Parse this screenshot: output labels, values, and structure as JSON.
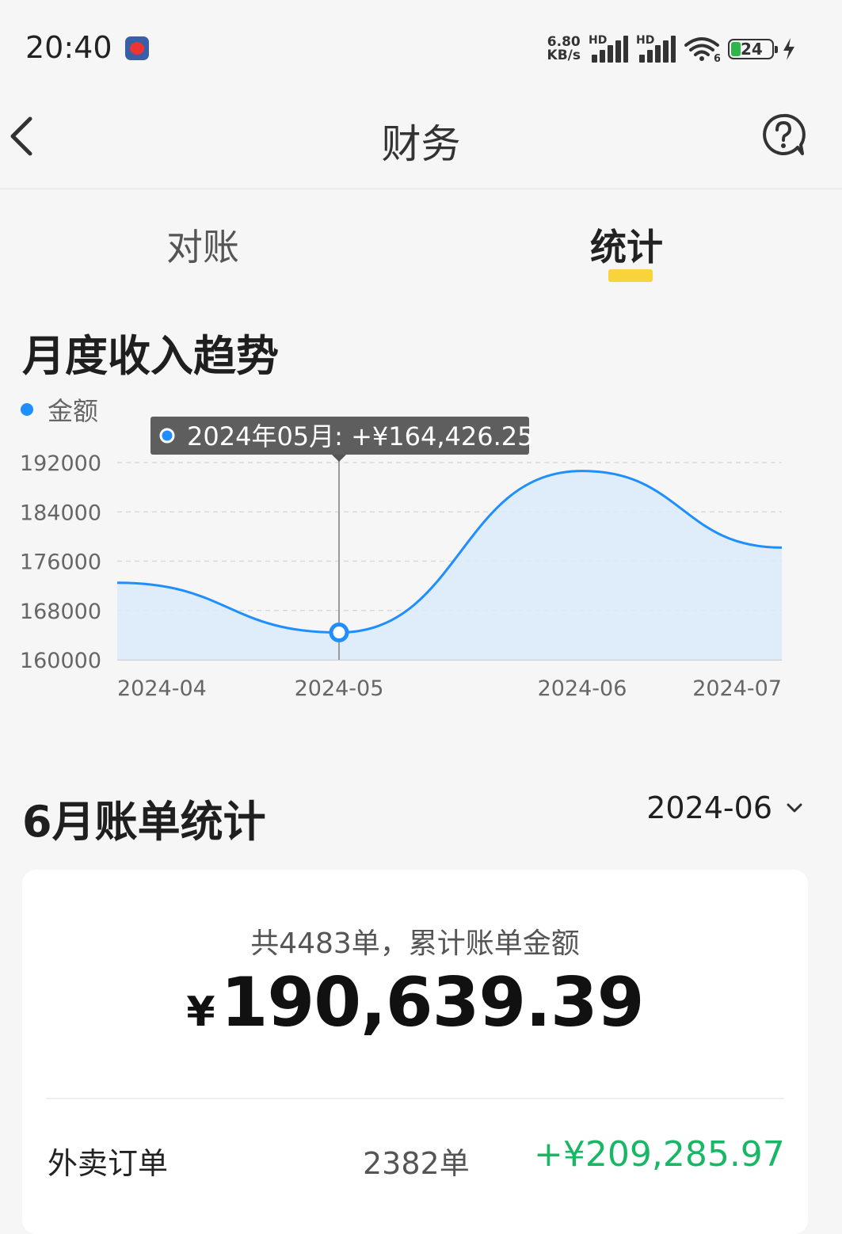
{
  "status_bar": {
    "time": "20:40",
    "net_speed_value": "6.80",
    "net_speed_unit": "KB/s",
    "signal_hd_1": "HD",
    "signal_hd_2": "HD",
    "wifi_label": "6",
    "battery": "24"
  },
  "nav": {
    "title": "财务"
  },
  "tabs": [
    {
      "label": "对账",
      "active": false
    },
    {
      "label": "统计",
      "active": true
    }
  ],
  "trend": {
    "title": "月度收入趋势",
    "legend_label": "金额",
    "tooltip": "2024年05月: +¥164,426.25"
  },
  "chart_data": {
    "type": "area",
    "title": "月度收入趋势",
    "series": [
      {
        "name": "金额",
        "values": [
          172500,
          164426.25,
          190639.39,
          178200
        ],
        "color": "#1f8fff"
      }
    ],
    "x": [
      "2024-04",
      "2024-05",
      "2024-06",
      "2024-07"
    ],
    "y_ticks": [
      192000,
      184000,
      176000,
      168000,
      160000
    ],
    "ylim": [
      160000,
      192000
    ],
    "grid": true,
    "legend": "top-left",
    "highlight_index": 1
  },
  "bill": {
    "title": "6月账单统计",
    "month": "2024-06"
  },
  "summary": {
    "caption": "共4483单，累计账单金额",
    "currency": "¥",
    "total": "190,639.39",
    "rows": [
      {
        "label": "外卖订单",
        "count": "2382单",
        "amount": "+¥209,285.97"
      }
    ]
  },
  "colors": {
    "accent": "#f7d33c",
    "series": "#1f8fff",
    "positive": "#18b765"
  }
}
